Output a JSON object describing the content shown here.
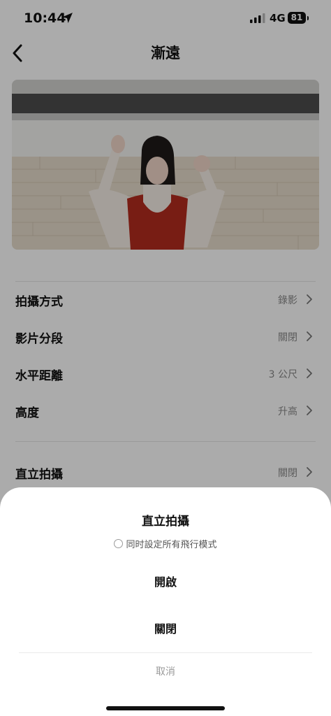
{
  "status_bar": {
    "time": "10:44",
    "network": "4G",
    "battery": "81"
  },
  "header": {
    "title": "漸遠"
  },
  "settings": {
    "items": [
      {
        "label": "拍攝方式",
        "value": "錄影"
      },
      {
        "label": "影片分段",
        "value": "關閉"
      },
      {
        "label": "水平距離",
        "value": "3 公尺"
      },
      {
        "label": "高度",
        "value": "升高"
      },
      {
        "label": "直立拍攝",
        "value": "關閉"
      }
    ]
  },
  "sheet": {
    "title": "直立拍攝",
    "apply_all_label": "同时設定所有飛行模式",
    "options": [
      "開啟",
      "關閉"
    ],
    "cancel_label": "取消"
  }
}
